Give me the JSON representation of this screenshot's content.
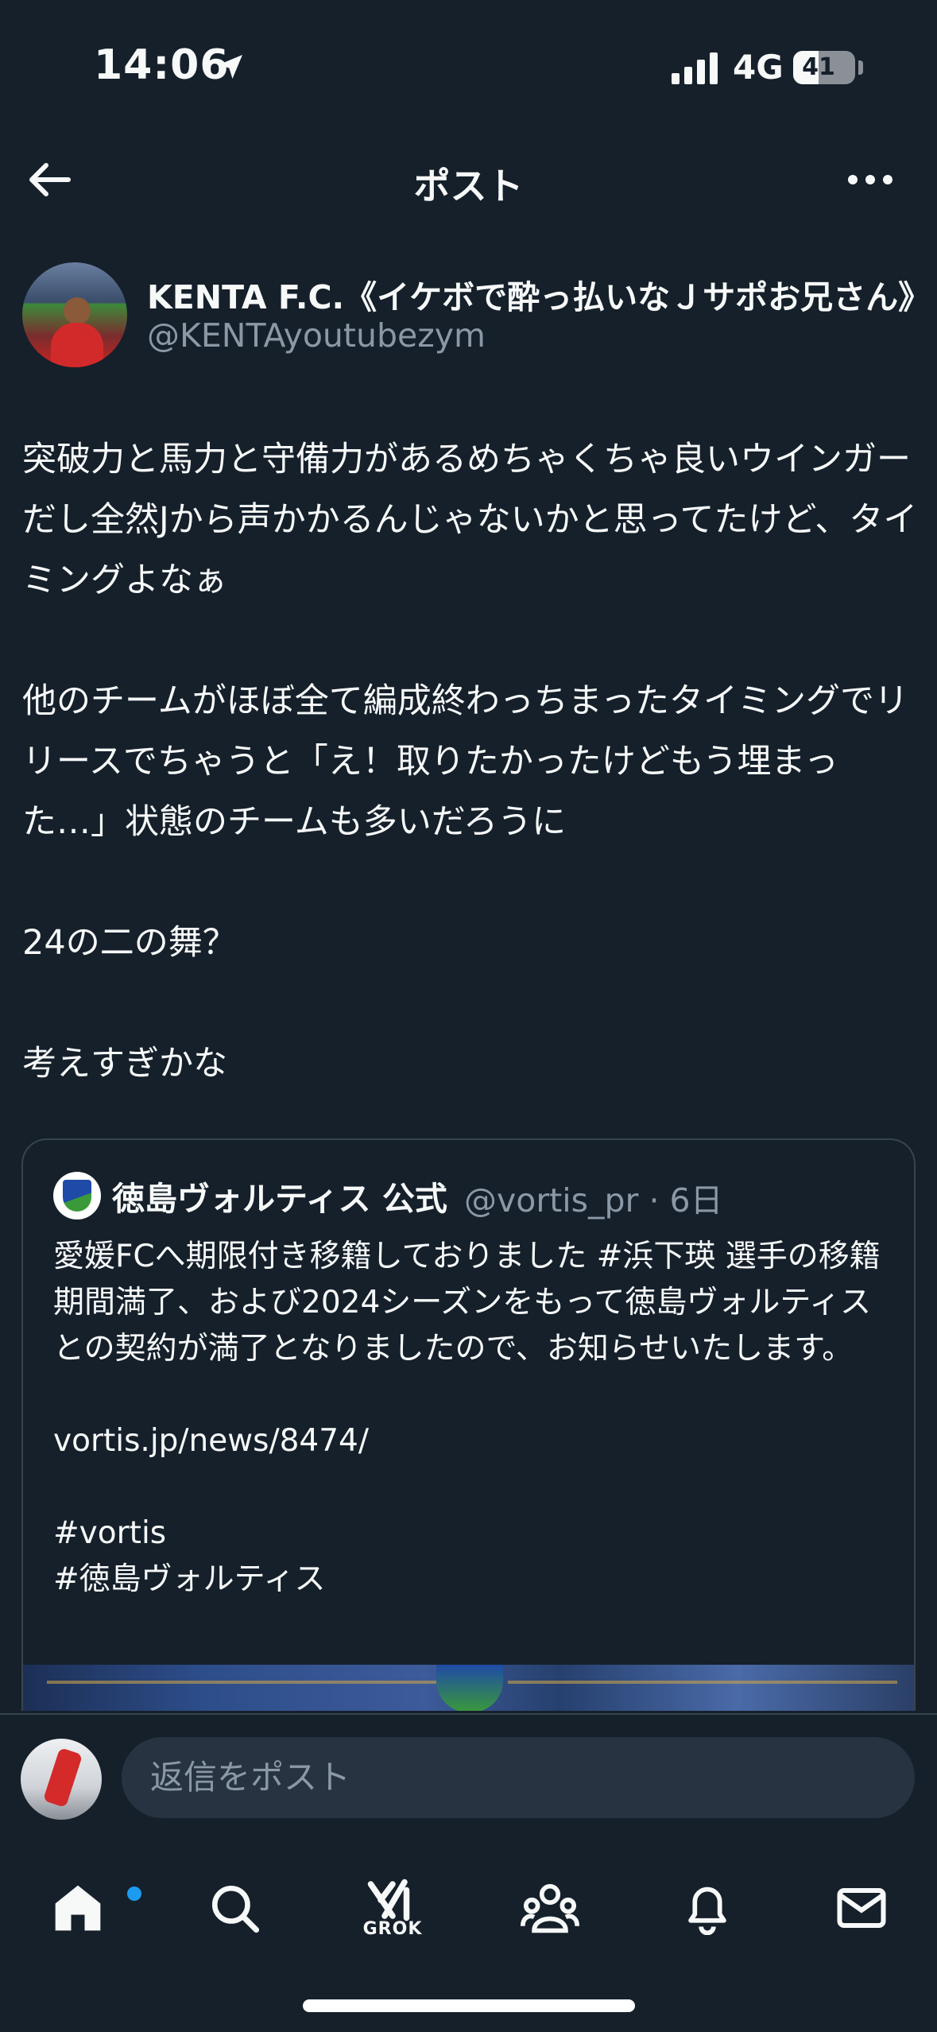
{
  "status_bar": {
    "time": "14:06",
    "network": "4G",
    "battery_percent": 41,
    "battery_label": "41"
  },
  "header": {
    "title": "ポスト"
  },
  "post": {
    "author_name": "KENTA F.C.《イケボで酔っ払いなＪサポお兄さん》",
    "author_handle": "@KENTAyoutubezym",
    "paragraphs": [
      "突破力と馬力と守備力があるめちゃくちゃ良いウインガーだし全然Jから声かかるんじゃないかと思ってたけど、タイミングよなぁ",
      "他のチームがほぼ全て編成終わっちまったタイミングでリリースでちゃうと「え！取りたかったけどもう埋まった…」状態のチームも多いだろうに",
      "24の二の舞？",
      "考えすぎかな"
    ]
  },
  "quote": {
    "name": "徳島ヴォルティス 公式",
    "handle_time": "@vortis_pr · 6日",
    "text_lines": [
      "愛媛FCへ期限付き移籍しておりました #浜下瑛 選手の移籍期間満了、および2024シーズンをもって徳島ヴォルティスとの契約が満了となりましたので、お知らせいたします。",
      "vortis.jp/news/8474/",
      "#vortis",
      "#徳島ヴォルティス"
    ]
  },
  "reply": {
    "placeholder": "返信をポスト"
  },
  "nav": {
    "grok_label": "GROK",
    "items": [
      "home-icon",
      "search-icon",
      "grok-icon",
      "communities-icon",
      "notifications-icon",
      "messages-icon"
    ]
  },
  "colors": {
    "background": "#15202b",
    "text": "#f7f9f9",
    "secondary_text": "#8b98a5",
    "border": "#38444d",
    "accent": "#1d9bf0"
  }
}
